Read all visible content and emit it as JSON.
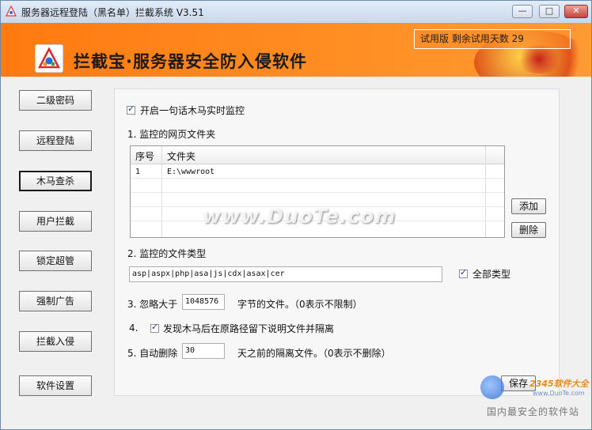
{
  "window": {
    "title": "服务器远程登陆（黑名单）拦截系统 V3.51",
    "controls": {
      "min": "—",
      "max": "□",
      "close": "✕"
    }
  },
  "banner": {
    "app_title": "拦截宝·服务器安全防入侵软件",
    "trial_text": "试用版 剩余试用天数 29"
  },
  "nav": {
    "items": [
      {
        "label": "二级密码"
      },
      {
        "label": "远程登陆"
      },
      {
        "label": "木马查杀"
      },
      {
        "label": "用户拦截"
      },
      {
        "label": "锁定超管"
      },
      {
        "label": "强制广告"
      },
      {
        "label": "拦截入侵"
      },
      {
        "label": "软件设置"
      }
    ],
    "active": "木马查杀"
  },
  "main": {
    "enable_monitor": {
      "label": "开启一句话木马实时监控",
      "checked": true
    },
    "section1_label": "1. 监控的网页文件夹",
    "table": {
      "headers": [
        "序号",
        "文件夹"
      ],
      "rows": [
        {
          "index": "1",
          "folder": "E:\\wwwroot"
        }
      ]
    },
    "add_button": "添加",
    "delete_button": "删除",
    "section2_label": "2. 监控的文件类型",
    "file_types_value": "asp|aspx|php|asa|js|cdx|asax|cer",
    "all_types": {
      "label": "全部类型",
      "checked": true
    },
    "section3": {
      "prefix": "3. 忽略大于",
      "value": "1048576",
      "suffix": "字节的文件。（0表示不限制）"
    },
    "section4": {
      "number": "4.",
      "label": "发现木马后在原路径留下说明文件并隔离",
      "checked": true
    },
    "section5": {
      "prefix": "5. 自动删除",
      "value": "30",
      "suffix": "天之前的隔离文件。（0表示不删除）"
    },
    "save_button": "保存"
  },
  "watermarks": {
    "center": "www.DuoTe.com",
    "badge_top": "2345软件大全",
    "badge_sub": "www.DuoTe.com",
    "badge_bottom": "国内最安全的软件站"
  },
  "colors": {
    "banner": "#ff8417",
    "title_bar": "#d3e1f2",
    "panel": "#f7f7f7"
  }
}
